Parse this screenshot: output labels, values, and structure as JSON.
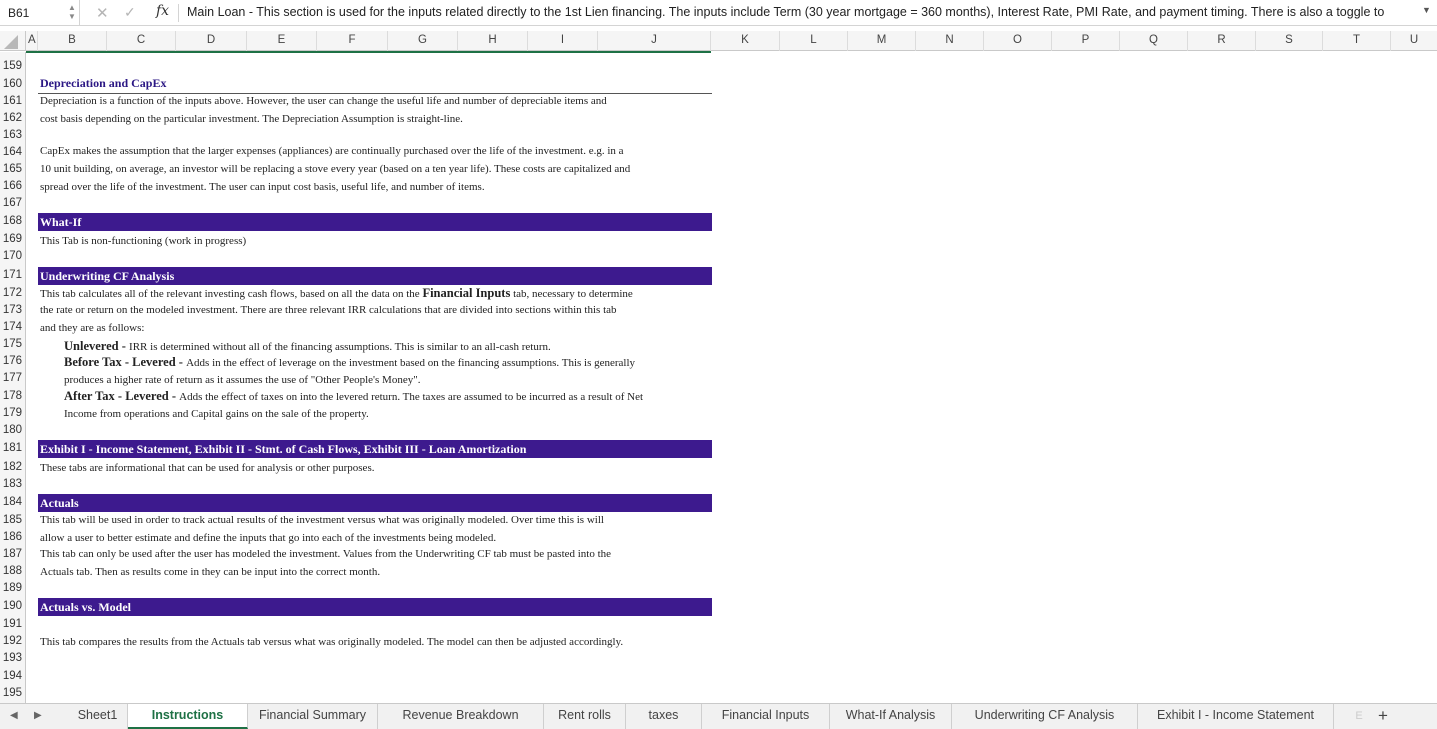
{
  "formula_bar": {
    "cell_ref": "B61",
    "cancel_icon": "✕",
    "enter_icon": "✓",
    "fx_label": "fx",
    "content": "Main Loan - This section is used for the inputs related directly to the 1st Lien financing.  The inputs include Term (30 year mortgage = 360 months), Interest Rate, PMI Rate, and payment timing.  There is also a toggle to"
  },
  "columns": [
    "A",
    "B",
    "C",
    "D",
    "E",
    "F",
    "G",
    "H",
    "I",
    "J",
    "K",
    "L",
    "M",
    "N",
    "O",
    "P",
    "Q",
    "R",
    "S",
    "T",
    "U"
  ],
  "rows": [
    "159",
    "160",
    "161",
    "162",
    "163",
    "164",
    "165",
    "166",
    "167",
    "168",
    "169",
    "170",
    "171",
    "172",
    "173",
    "174",
    "175",
    "176",
    "177",
    "178",
    "179",
    "180",
    "181",
    "182",
    "183",
    "184",
    "185",
    "186",
    "187",
    "188",
    "189",
    "190",
    "191",
    "192",
    "193",
    "194",
    "195"
  ],
  "content": {
    "depreciation": {
      "title": "Depreciation and CapEx",
      "l1": "Depreciation is a function of the inputs above.  However, the user can change the useful life and number of depreciable items and",
      "l2": "cost basis depending on the particular investment.  The Depreciation Assumption is straight-line.",
      "l3": "CapEx makes the assumption that the larger expenses (appliances) are continually purchased over the life of the investment.  e.g. in a",
      "l4": "10 unit building, on average, an investor will be replacing a stove every year (based on a ten year life).  These costs are capitalized and",
      "l5": "spread over the life of the investment.  The user can input cost basis, useful life, and number of items."
    },
    "whatif": {
      "title": "What-If",
      "l1": "This Tab is non-functioning (work in progress)"
    },
    "underwriting": {
      "title": "Underwriting CF Analysis",
      "l1a": "This tab calculates all of the relevant investing cash flows, based on all the data on the ",
      "l1b": "Financial Inputs",
      "l1c": " tab, necessary to determine",
      "l2": "the rate or return on the modeled investment.  There are three relevant IRR calculations that are divided into sections within this tab",
      "l3": "and they are as follows:",
      "unlev_label": "Unlevered - ",
      "unlev_text": "IRR is determined without all of the financing assumptions.  This is similar to an all-cash return.",
      "btl_label": "Before Tax - Levered - ",
      "btl_text": "Adds in the effect of leverage on the investment based on the financing assumptions.  This is generally",
      "btl_text2": "produces a higher rate of return as it assumes the use of \"Other People's Money\".",
      "atl_label": "After Tax - Levered - ",
      "atl_text": "Adds the effect of taxes on into the levered return.  The taxes are assumed to be incurred as a result of Net",
      "atl_text2": "Income from operations and Capital gains on the sale of the property."
    },
    "exhibits": {
      "title": "Exhibit I - Income Statement, Exhibit II - Stmt. of Cash Flows, Exhibit III - Loan Amortization",
      "l1": "These tabs are informational that can be used for analysis or other purposes."
    },
    "actuals": {
      "title": "Actuals",
      "l1": "This tab will be used in order to track actual results of the investment versus what was originally modeled.  Over time this is will",
      "l2": "allow a user to better estimate and define the inputs that go into each of the investments being modeled.",
      "l3": "This tab can only be used after the user has modeled the investment.  Values from the Underwriting CF tab must be pasted into the",
      "l4": "Actuals tab.  Then as results come in they can be input into the correct month."
    },
    "actuals_vs_model": {
      "title": "Actuals vs. Model",
      "l1": "This tab compares the results from the Actuals tab versus what was originally modeled.  The model can then be adjusted accordingly."
    }
  },
  "tabs": {
    "prev_icon": "◀",
    "next_icon": "▶",
    "items": [
      "Sheet1",
      "Instructions",
      "Financial Summary",
      "Revenue Breakdown",
      "Rent rolls",
      "taxes",
      "Financial Inputs",
      "What-If Analysis",
      "Underwriting CF Analysis",
      "Exhibit I - Income Statement"
    ],
    "active": "Instructions",
    "overflow": "E",
    "add_icon": "+"
  },
  "colors": {
    "section_bar": "#3d1a8e",
    "accent_green": "#1e7145",
    "title_blue": "#2b1784"
  }
}
